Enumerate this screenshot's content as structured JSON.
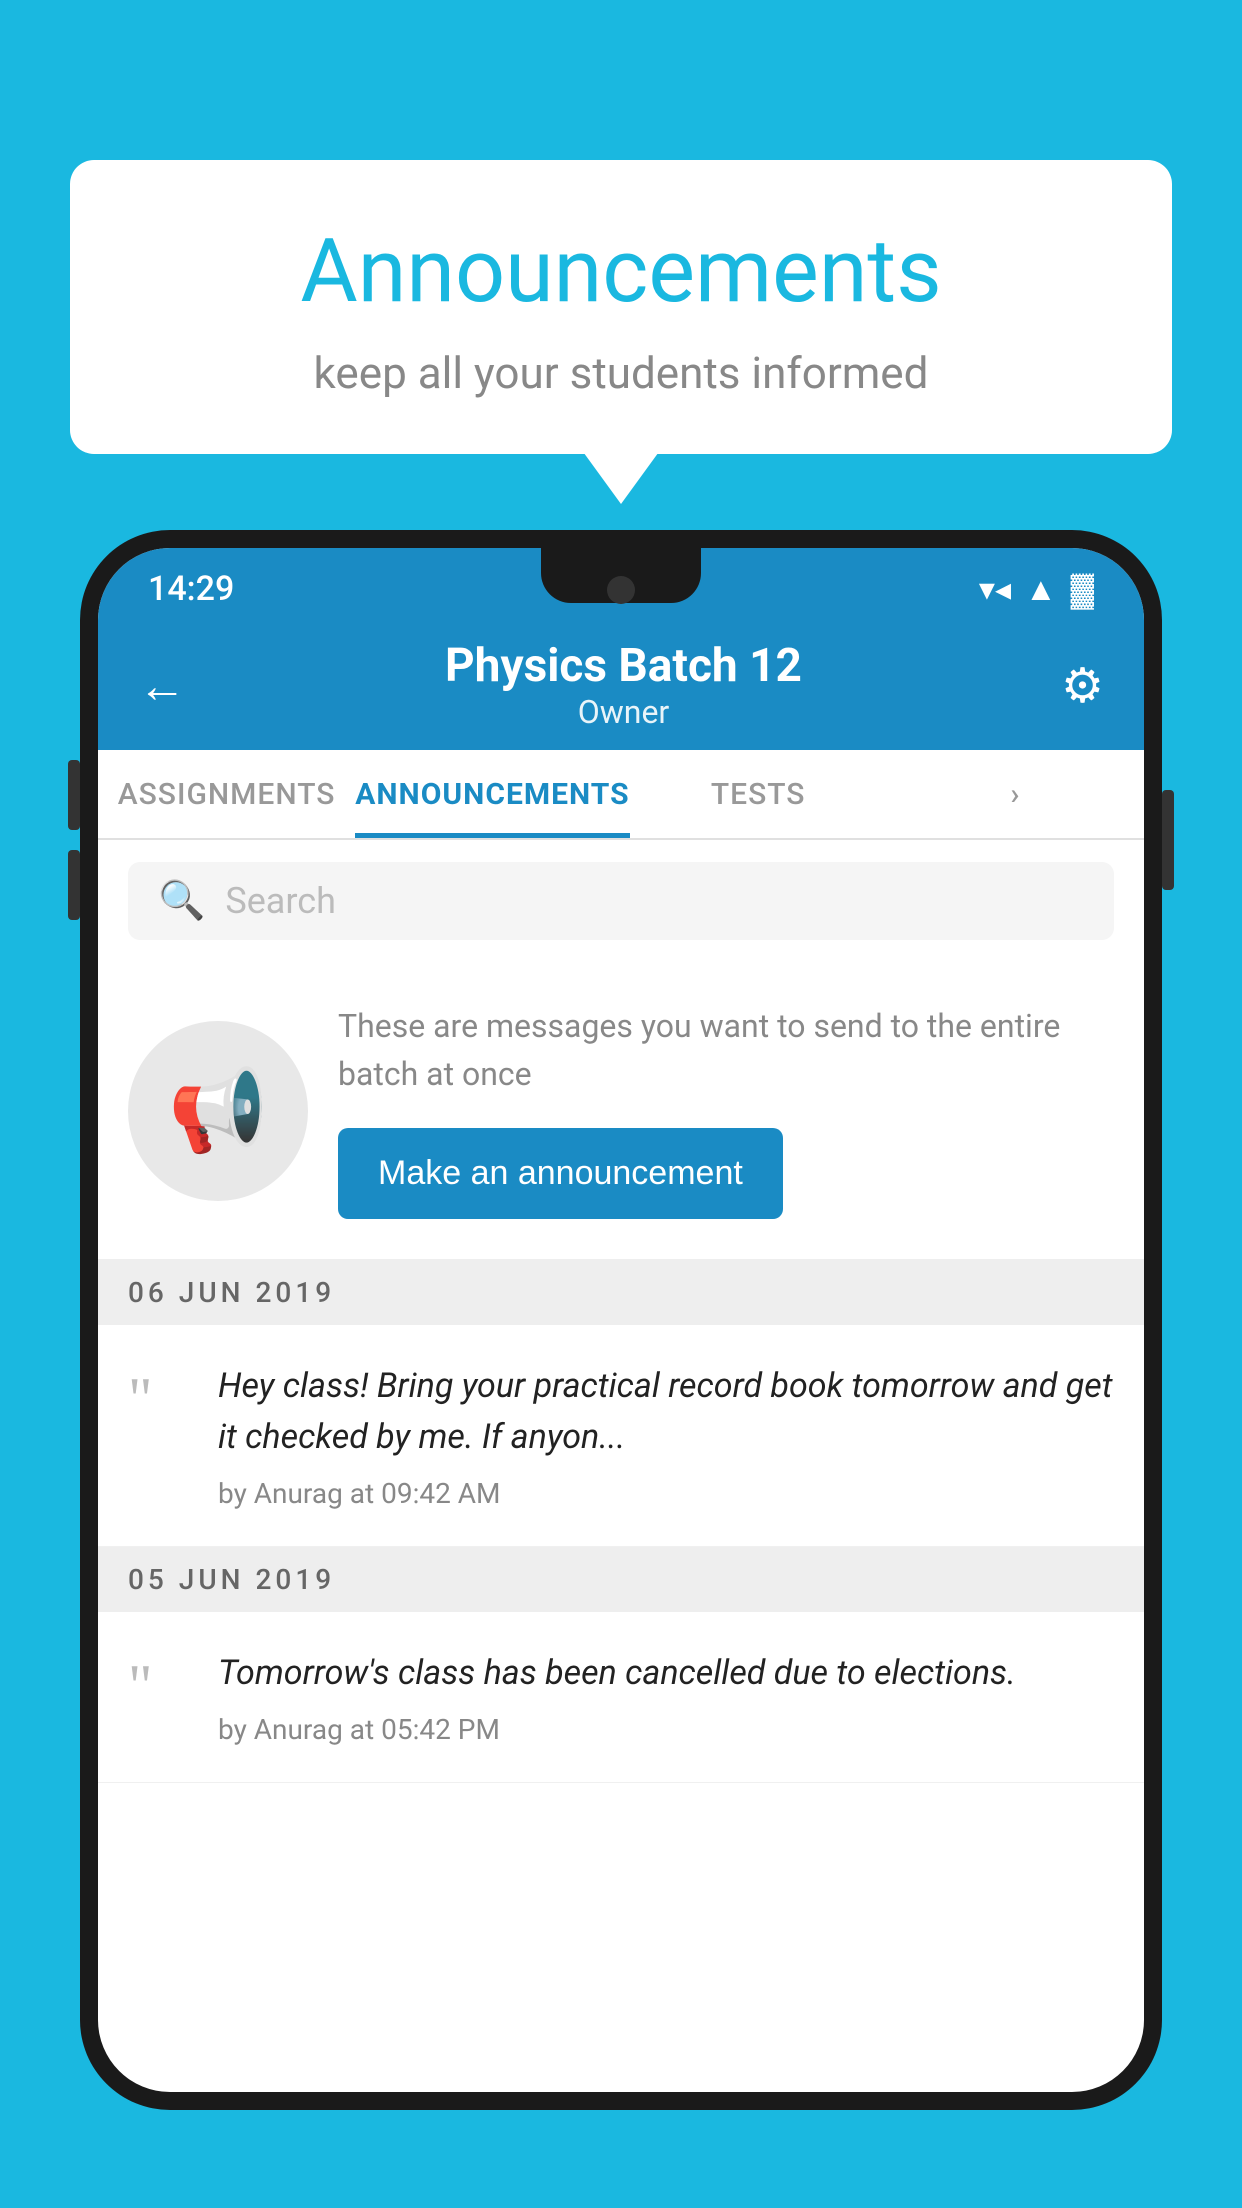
{
  "background_color": "#1ab8e0",
  "speech_bubble": {
    "title": "Announcements",
    "subtitle": "keep all your students informed"
  },
  "phone": {
    "status_bar": {
      "time": "14:29",
      "wifi": "▼▲",
      "signal": "▲",
      "battery": "▓"
    },
    "header": {
      "title": "Physics Batch 12",
      "subtitle": "Owner",
      "back_label": "←",
      "gear_label": "⚙"
    },
    "tabs": [
      {
        "label": "ASSIGNMENTS",
        "active": false
      },
      {
        "label": "ANNOUNCEMENTS",
        "active": true
      },
      {
        "label": "TESTS",
        "active": false
      },
      {
        "label": "...",
        "active": false
      }
    ],
    "search": {
      "placeholder": "Search"
    },
    "promo": {
      "description": "These are messages you want to send to the entire batch at once",
      "button_label": "Make an announcement"
    },
    "announcements": [
      {
        "date": "06  JUN  2019",
        "text": "Hey class! Bring your practical record book tomorrow and get it checked by me. If anyon...",
        "meta": "by Anurag at 09:42 AM"
      },
      {
        "date": "05  JUN  2019",
        "text": "Tomorrow's class has been cancelled due to elections.",
        "meta": "by Anurag at 05:42 PM"
      }
    ]
  }
}
